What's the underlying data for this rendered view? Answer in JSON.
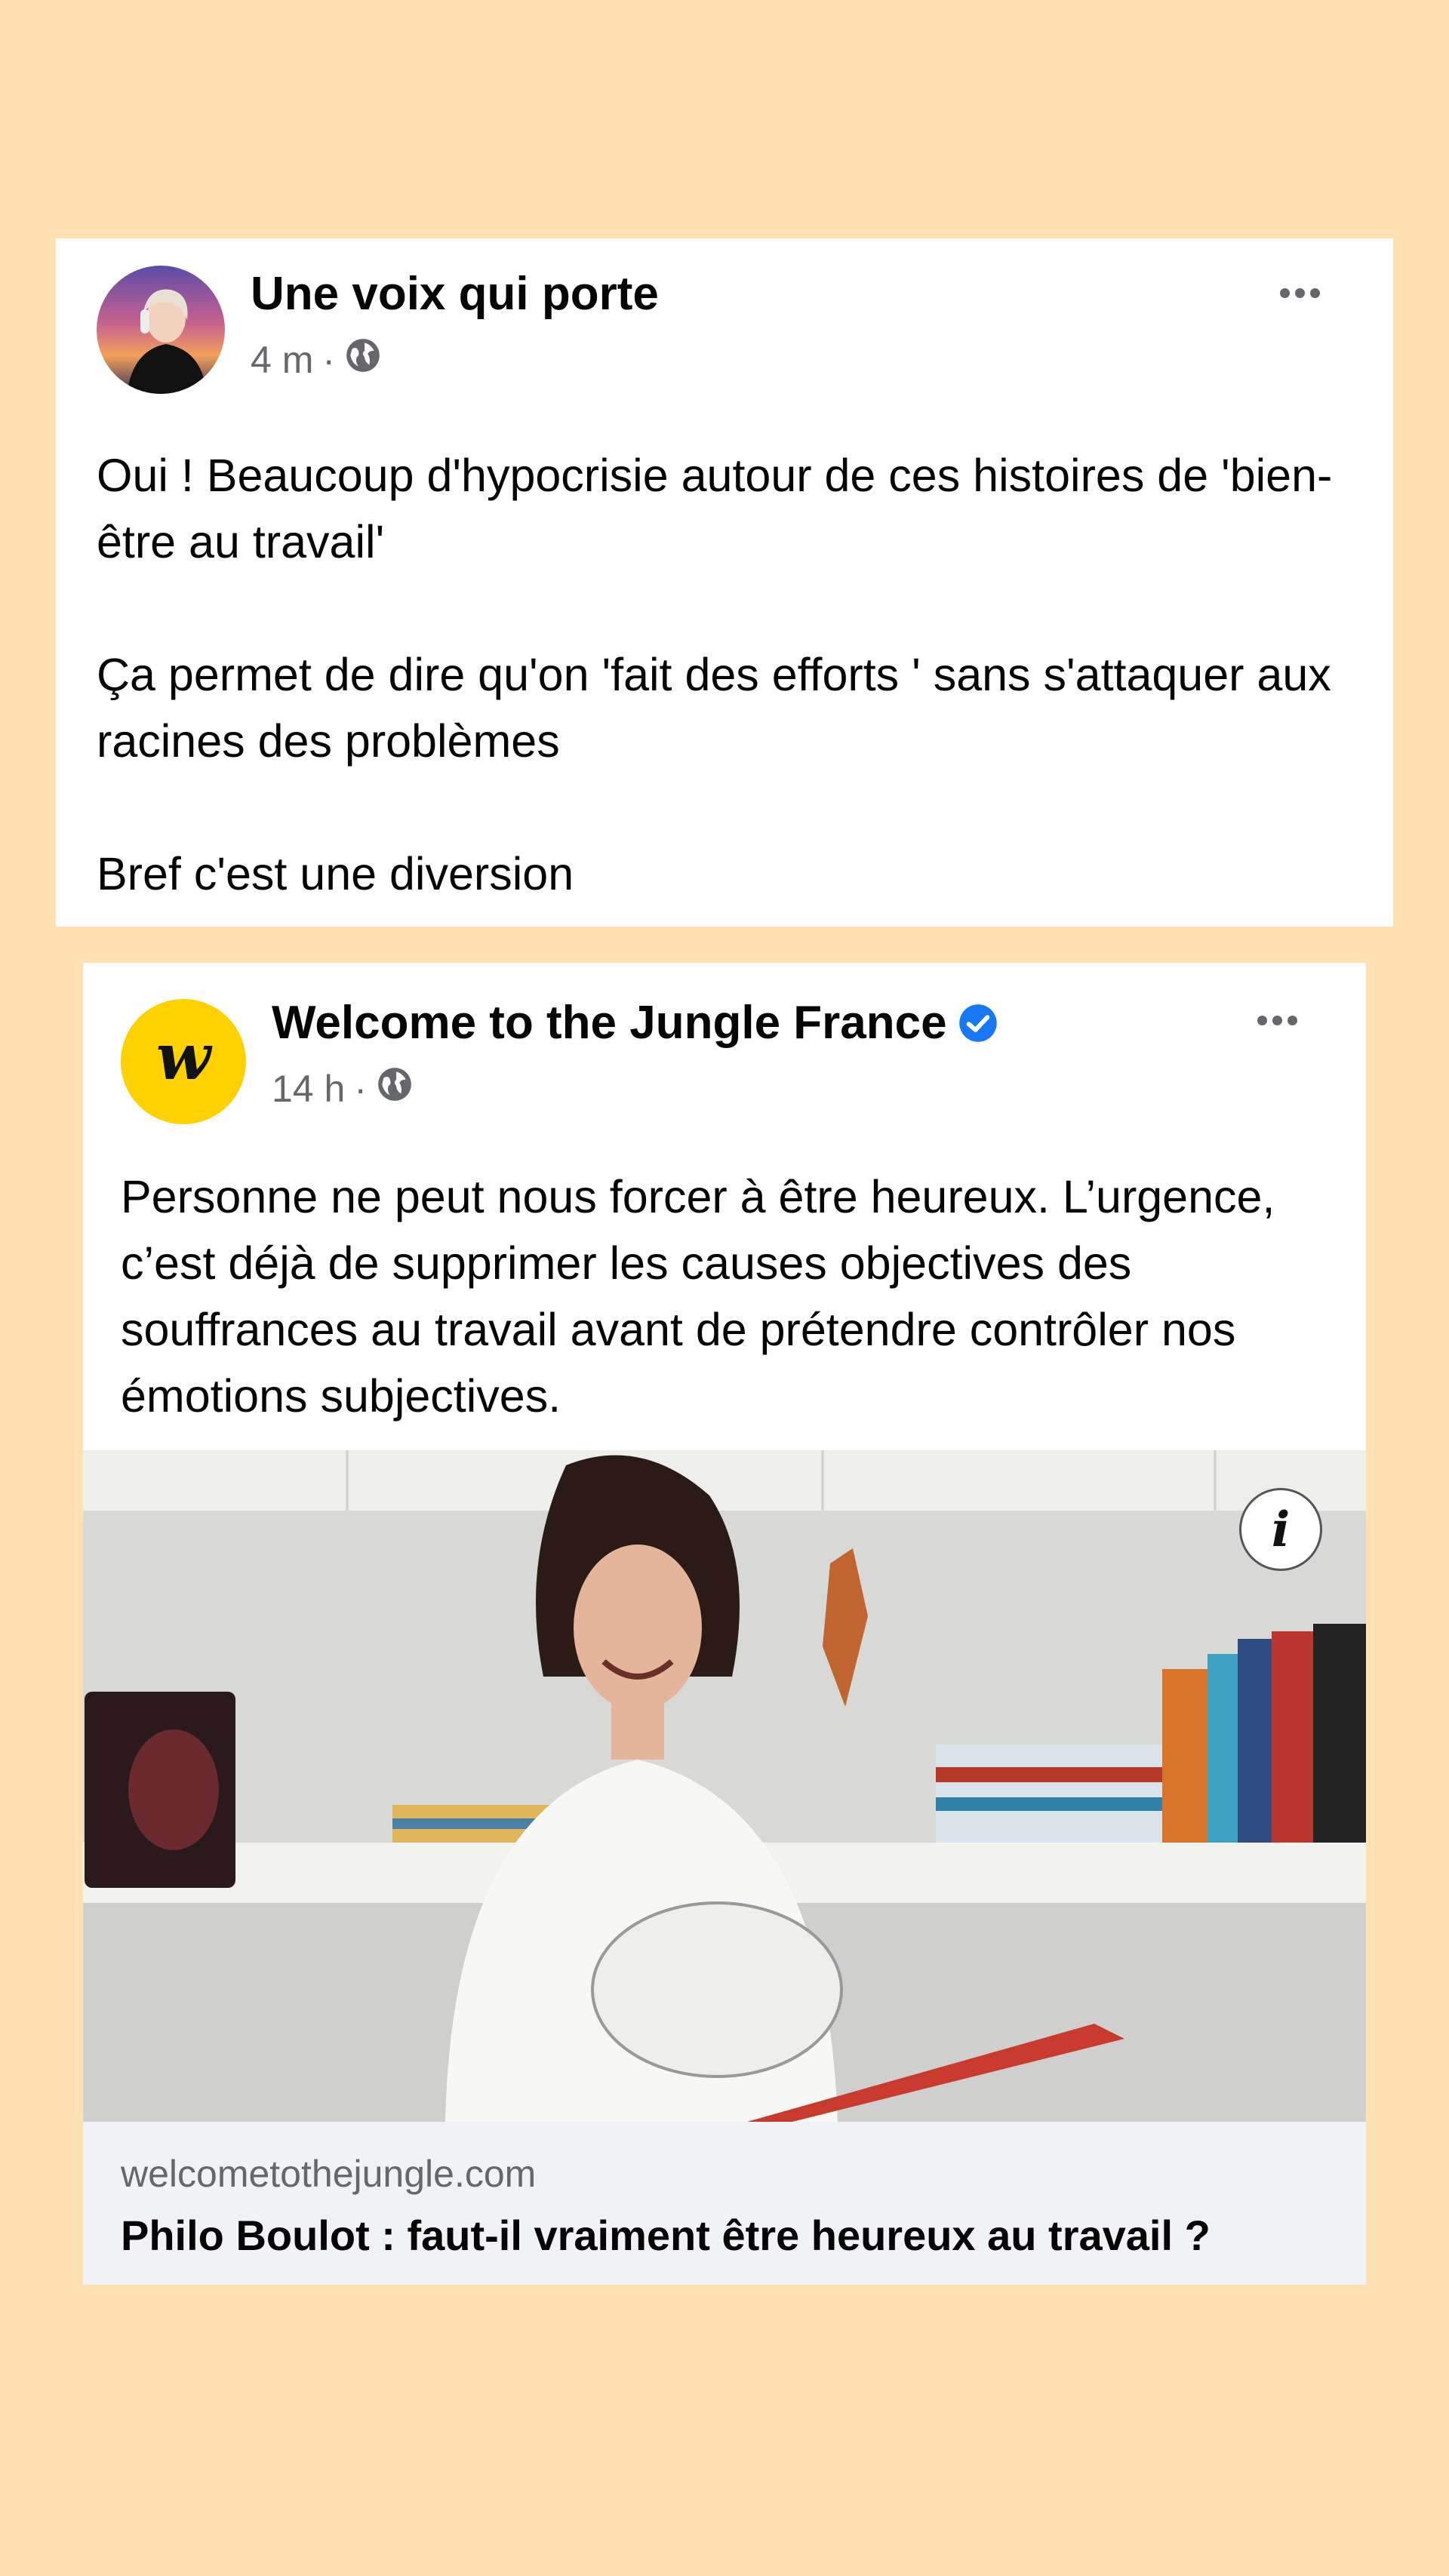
{
  "post1": {
    "author": "Une voix qui porte",
    "time": "4 m",
    "separator": "·",
    "paragraphs": [
      "Oui ! Beaucoup d'hypocrisie autour de ces histoires de 'bien-être au travail'",
      "Ça permet de dire qu'on 'fait des efforts ' sans s'attaquer aux racines des problèmes",
      "Bref c'est une diversion"
    ]
  },
  "post2": {
    "author": "Welcome to the Jungle France",
    "avatar_letter": "w",
    "time": "14 h",
    "separator": "·",
    "text": "Personne ne peut nous forcer à être heureux. L’urgence, c’est déjà de supprimer les causes objectives des souffrances au travail avant de prétendre contrôler nos émotions subjectives.",
    "info_icon": "i",
    "link": {
      "domain": "welcometothejungle.com",
      "title": "Philo Boulot : faut-il vraiment être heureux au travail ?"
    }
  },
  "colors": {
    "background": "#FFE1B4",
    "verified": "#1877F2",
    "meta": "#65676B",
    "brand_yellow": "#FFD100"
  },
  "icons": [
    "globe-icon",
    "more-options-icon",
    "verified-badge-icon",
    "info-icon"
  ]
}
